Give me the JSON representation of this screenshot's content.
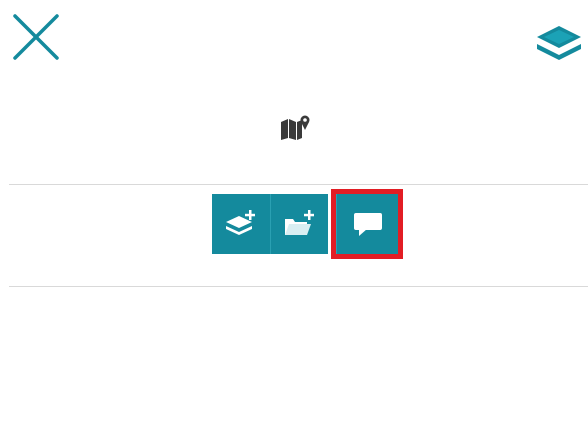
{
  "header": {
    "close_icon": "close-icon",
    "layers_icon": "layers-icon"
  },
  "title_icon": "map-pin-icon",
  "toolbar": {
    "buttons": [
      {
        "icon": "add-layer-icon"
      },
      {
        "icon": "add-folder-icon"
      },
      {
        "icon": "comment-icon",
        "highlighted": true
      }
    ]
  },
  "colors": {
    "accent": "#148a9d",
    "highlight": "#e21d24",
    "divider": "#d9d9d9"
  }
}
